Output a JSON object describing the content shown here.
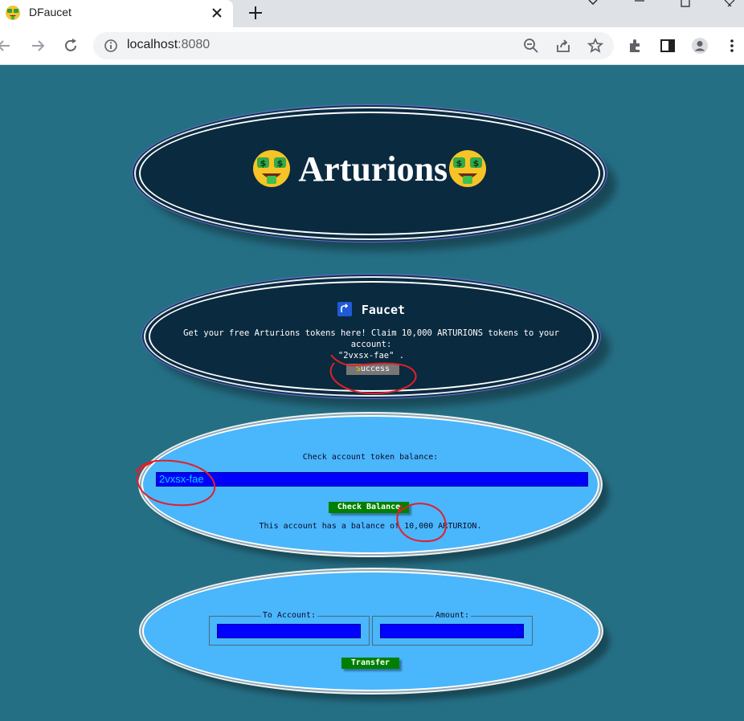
{
  "browser": {
    "tab_title": "DFaucet",
    "url_host": "localhost",
    "url_port": ":8080"
  },
  "hero": {
    "title": "Arturions"
  },
  "faucet": {
    "heading": "Faucet",
    "description": "Get your free Arturions tokens here! Claim 10,000 ARTURIONS tokens to your account:",
    "account_quoted": "\"2vxsx-fae\" .",
    "button_first": "S",
    "button_rest": "uccess"
  },
  "balance": {
    "label": "Check account token balance:",
    "account_value": "2vxsx-fae",
    "button_label": "Check Balance",
    "result": "This account has a balance of 10,000 ARTURION."
  },
  "transfer": {
    "to_label": "To Account:",
    "amount_label": "Amount:",
    "button_label": "Transfer"
  },
  "colors": {
    "page_bg": "#256f85",
    "dark_oval": "#0a2a3f",
    "light_oval": "#4ab6fc",
    "input_blue": "#0000ff",
    "button_green": "#008000",
    "annotation_red": "#e0202a"
  }
}
